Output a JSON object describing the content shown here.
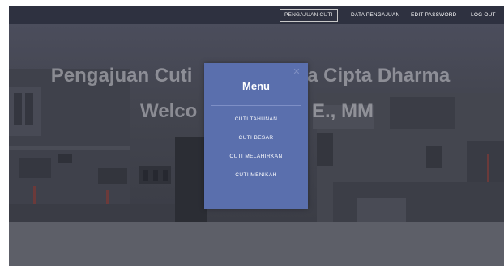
{
  "navbar": {
    "items": [
      {
        "label": "PENGAJUAN CUTI",
        "active": true
      },
      {
        "label": "DATA PENGAJUAN",
        "active": false
      },
      {
        "label": "EDIT PASSWORD",
        "active": false
      },
      {
        "label": "LOG OUT",
        "active": false
      }
    ]
  },
  "hero": {
    "title_visible_left": "Pengajuan Cuti",
    "title_visible_right": "a Cipta Dharma",
    "welcome_visible_left": "Welco",
    "welcome_visible_right": "E., MM"
  },
  "modal": {
    "title": "Menu",
    "close_icon": "close-icon",
    "items": [
      {
        "label": "CUTI TAHUNAN"
      },
      {
        "label": "CUTI BESAR"
      },
      {
        "label": "CUTI MELAHIRKAN"
      },
      {
        "label": "CUTI MENIKAH"
      }
    ]
  },
  "colors": {
    "navbar": "#2e3140",
    "modal": "#5a6fad",
    "overlay": "#43454f",
    "footer": "#5d5f68"
  }
}
